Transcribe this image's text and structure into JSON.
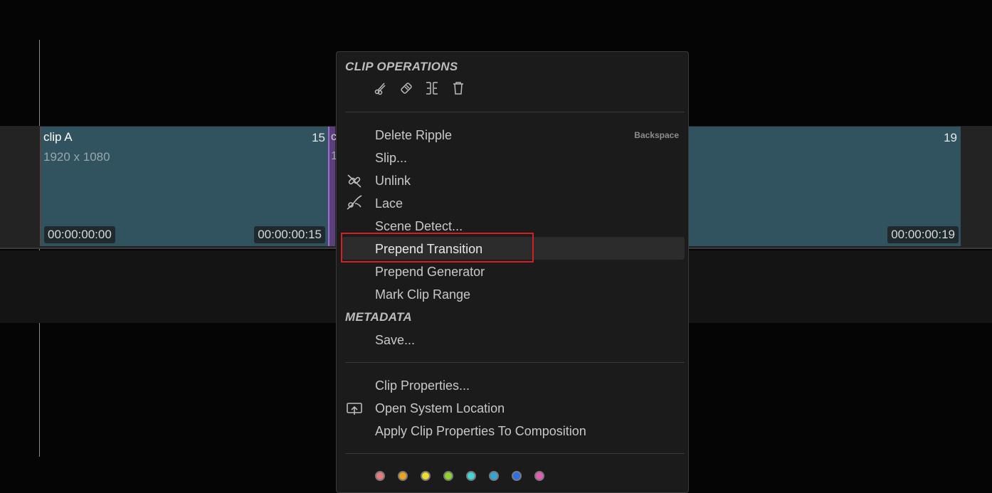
{
  "timeline": {
    "clip_a": {
      "name": "clip A",
      "resolution": "1920 x 1080",
      "frame_count": "15",
      "timecode_start": "00:00:00:00",
      "timecode_end": "00:00:00:15"
    },
    "clip_b": {
      "name_fragment": "c",
      "resolution_fragment": "1"
    },
    "clip_c": {
      "frame_count": "19",
      "timecode_end": "00:00:00:19"
    }
  },
  "context_menu": {
    "clip_operations_header": "CLIP OPERATIONS",
    "toolbar_icons": [
      "scissors-icon",
      "ripple-blade-icon",
      "split-icon",
      "trash-icon"
    ],
    "items": [
      {
        "label": "Delete Ripple",
        "shortcut": "Backspace",
        "icon": null
      },
      {
        "label": "Slip...",
        "shortcut": "",
        "icon": null
      },
      {
        "label": "Unlink",
        "shortcut": "",
        "icon": "unlink-icon"
      },
      {
        "label": "Lace",
        "shortcut": "",
        "icon": "lace-icon"
      },
      {
        "label": "Scene Detect...",
        "shortcut": "",
        "icon": null
      },
      {
        "label": "Prepend Transition",
        "shortcut": "",
        "icon": null,
        "highlighted": true
      },
      {
        "label": "Prepend Generator",
        "shortcut": "",
        "icon": null
      },
      {
        "label": "Mark Clip Range",
        "shortcut": "",
        "icon": null
      }
    ],
    "metadata_header": "METADATA",
    "metadata_items": [
      {
        "label": "Save...",
        "icon": null
      }
    ],
    "properties_items": [
      {
        "label": "Clip Properties...",
        "icon": null
      },
      {
        "label": "Open System Location",
        "icon": "open-location-icon"
      },
      {
        "label": "Apply Clip Properties To Composition",
        "icon": null
      }
    ],
    "color_labels": [
      "#e87a7a",
      "#f0a21e",
      "#eedc2e",
      "#8ed42a",
      "#3fd6d6",
      "#2ea8d8",
      "#2d6fe6",
      "#e65ab6"
    ]
  },
  "colors": {
    "clip": "#30535f",
    "menu_bg": "#1b1b1b",
    "highlight_border": "#d42020"
  }
}
